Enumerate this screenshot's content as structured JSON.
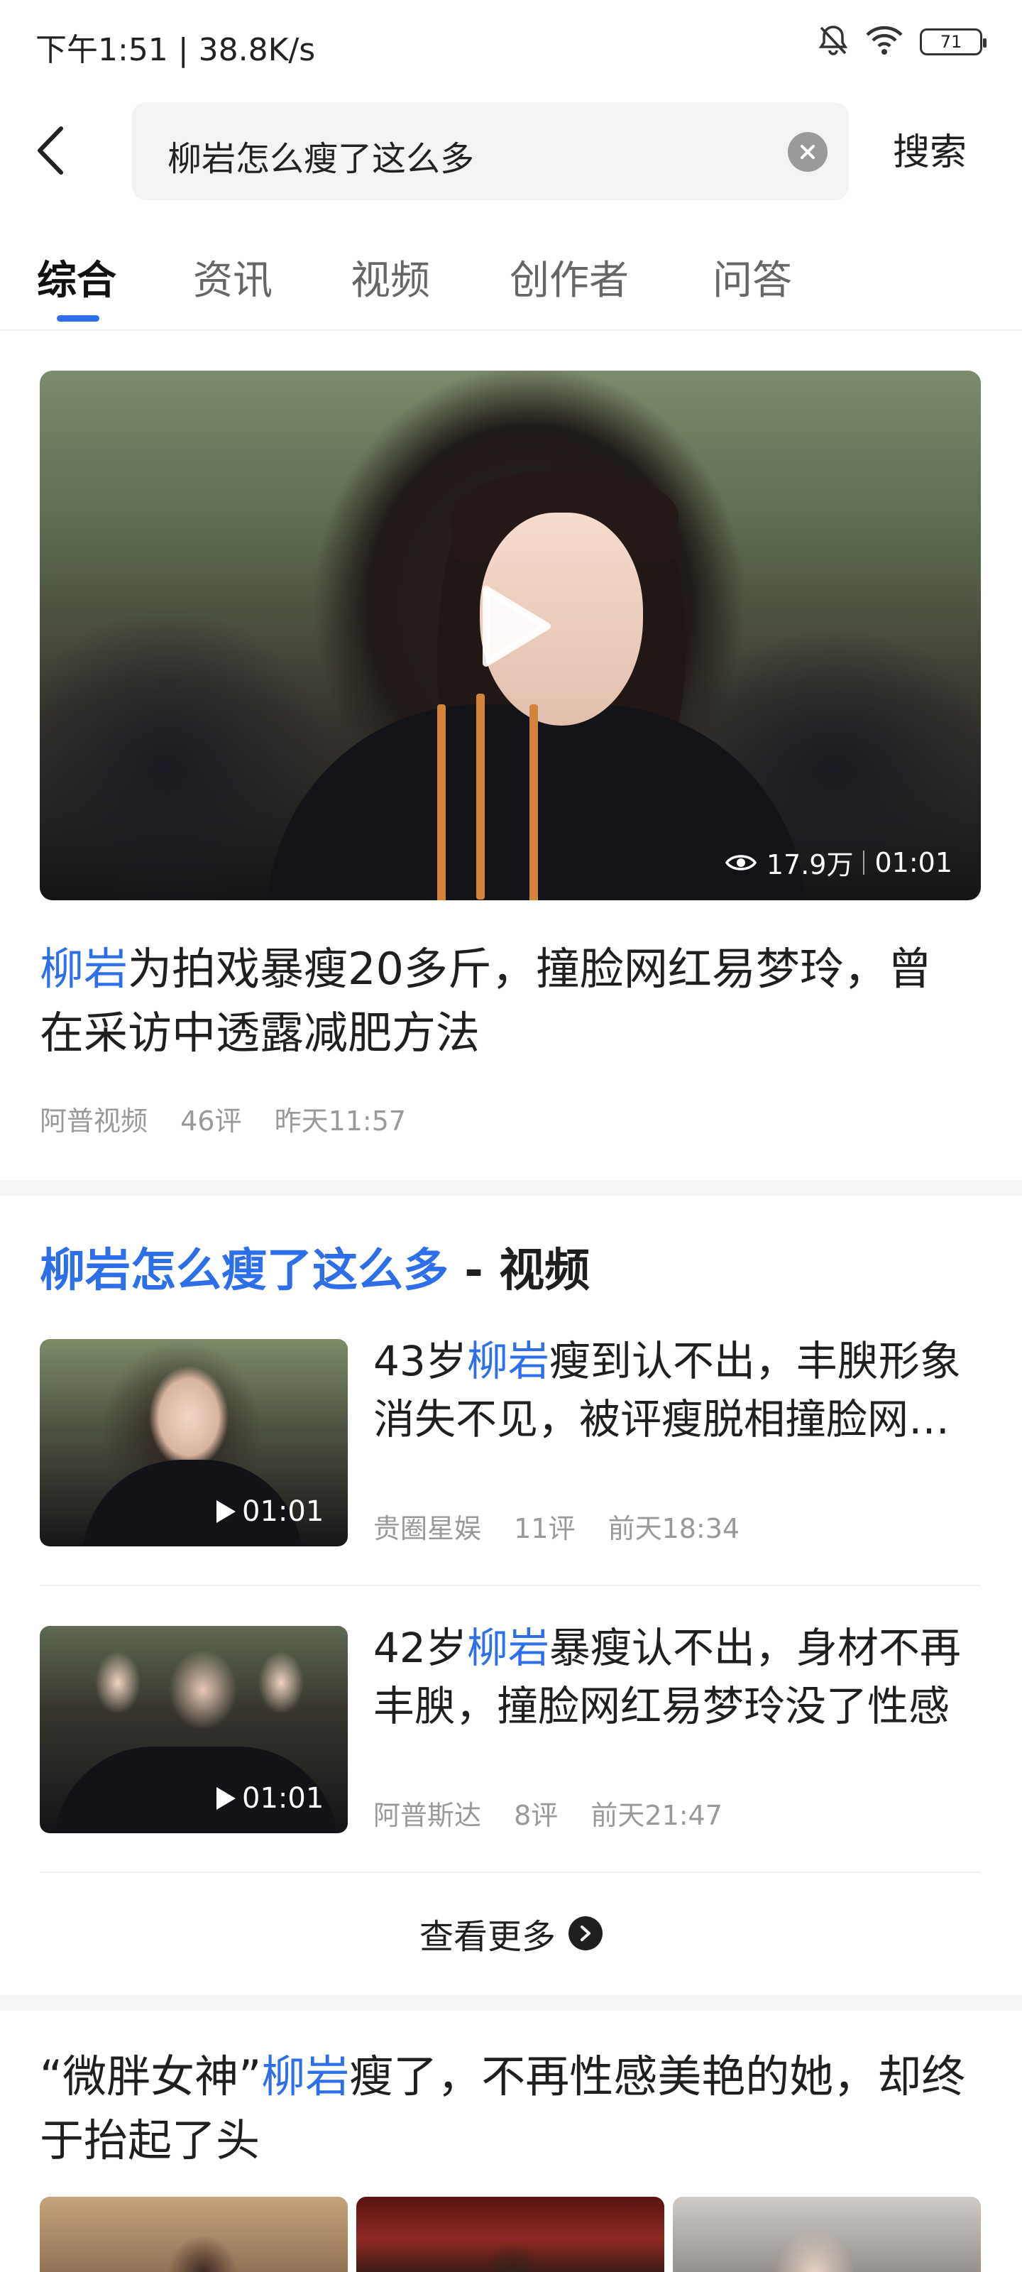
{
  "status_bar": {
    "time": "下午1:51 | 38.8K/s",
    "battery": "71",
    "icons": [
      "bell-off-icon",
      "wifi-icon",
      "battery-icon"
    ]
  },
  "search": {
    "query": "柳岩怎么瘦了这么多",
    "button": "搜索"
  },
  "tabs": [
    {
      "label": "综合",
      "active": true
    },
    {
      "label": "资讯"
    },
    {
      "label": "视频"
    },
    {
      "label": "创作者"
    },
    {
      "label": "问答"
    }
  ],
  "featured": {
    "views": "17.9万",
    "duration": "01:01",
    "title_highlight": "柳岩",
    "title_rest": "为拍戏暴瘦20多斤，撞脸网红易梦玲，曾在采访中透露减肥方法",
    "source": "阿普视频",
    "comments": "46评",
    "time": "昨天11:57"
  },
  "video_section": {
    "title_highlight": "柳岩怎么瘦了这么多",
    "title_suffix": " - 视频",
    "items": [
      {
        "prefix": "43岁",
        "highlight": "柳岩",
        "rest": "瘦到认不出，丰腴形象消失不见，被评瘦脱相撞脸网红易梦玲",
        "duration": "01:01",
        "source": "贵圈星娱",
        "comments": "11评",
        "time": "前天18:34"
      },
      {
        "prefix": "42岁",
        "highlight": "柳岩",
        "rest": "暴瘦认不出，身材不再丰腴，撞脸网红易梦玲没了性感",
        "duration": "01:01",
        "source": "阿普斯达",
        "comments": "8评",
        "time": "前天21:47"
      }
    ],
    "more": "查看更多"
  },
  "article": {
    "prefix": "“微胖女神”",
    "highlight": "柳岩",
    "rest": "瘦了，不再性感美艳的她，却终于抬起了头"
  },
  "colors": {
    "accent": "#2d6fe8",
    "text": "#1f1f1f",
    "meta": "#999999"
  }
}
